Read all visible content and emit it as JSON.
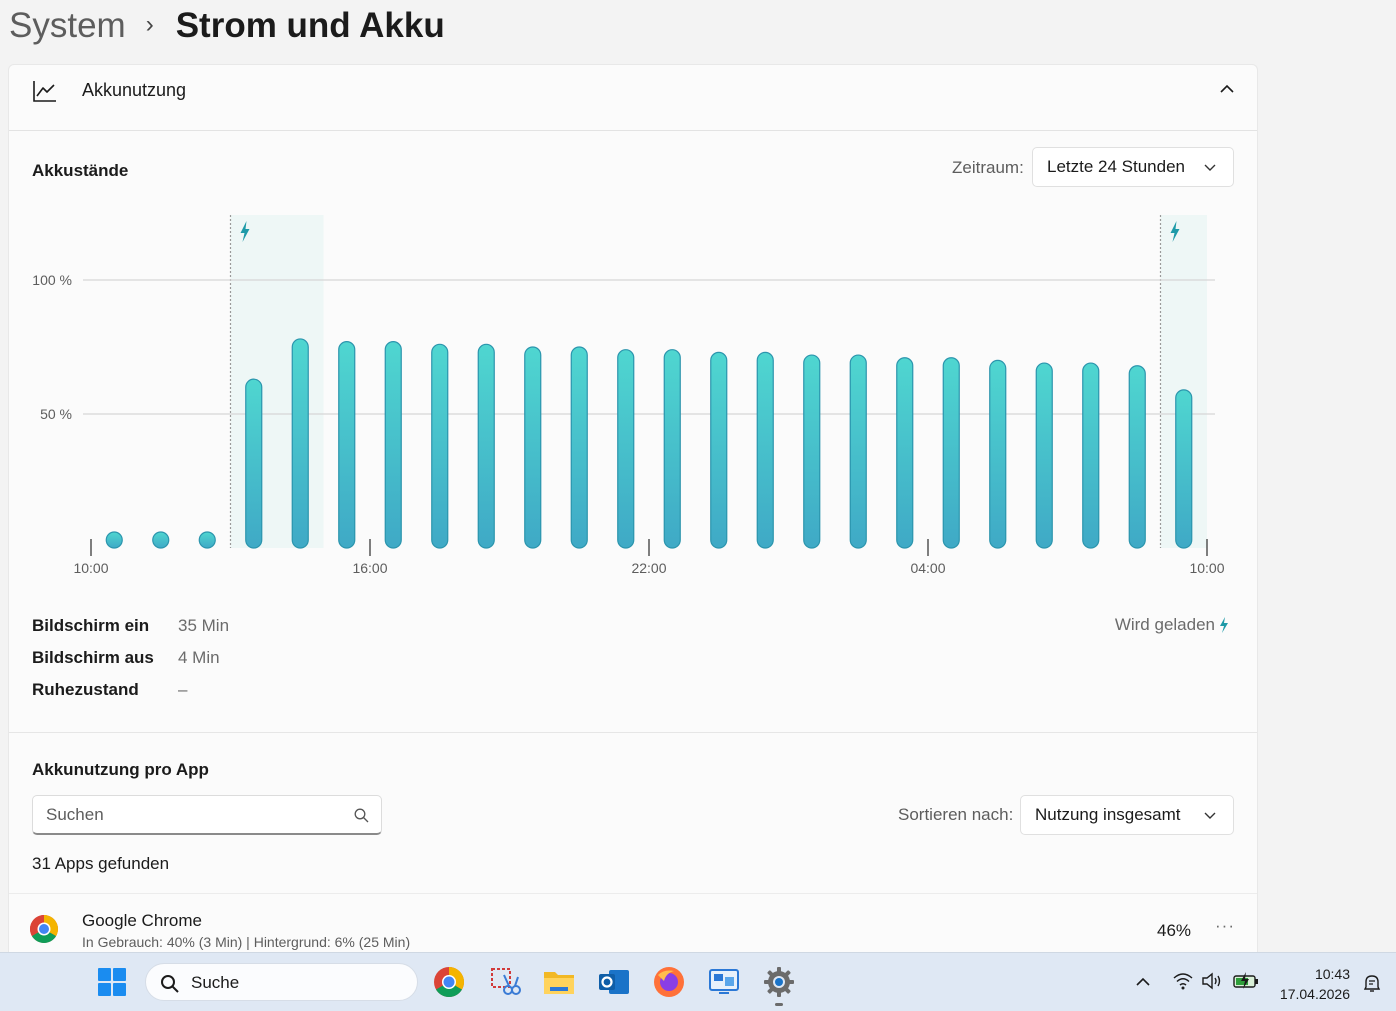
{
  "breadcrumb": {
    "parent": "System",
    "separator": "›",
    "current": "Strom und Akku"
  },
  "panel": {
    "title": "Akkunutzung"
  },
  "battery_levels": {
    "title": "Akkustände",
    "period_label": "Zeitraum:",
    "period_value": "Letzte 24 Stunden"
  },
  "chart_data": {
    "type": "bar",
    "y_ticks": [
      "100 %",
      "50 %"
    ],
    "ylim": [
      0,
      100
    ],
    "x_tick_labels": [
      "10:00",
      "16:00",
      "22:00",
      "04:00",
      "10:00"
    ],
    "x_tick_hours": [
      0,
      6,
      12,
      18,
      24
    ],
    "bar_hours": [
      0.5,
      1.5,
      2.5,
      3.5,
      4.5,
      5.5,
      6.5,
      7.5,
      8.5,
      9.5,
      10.5,
      11.5,
      12.5,
      13.5,
      14.5,
      15.5,
      16.5,
      17.5,
      18.5,
      19.5,
      20.5,
      21.5,
      22.5,
      23.5
    ],
    "values": [
      0,
      0,
      0,
      63,
      78,
      77,
      77,
      76,
      76,
      75,
      75,
      74,
      74,
      73,
      73,
      72,
      72,
      71,
      71,
      70,
      69,
      69,
      68,
      59
    ],
    "no_data_markers": [
      0,
      1,
      2
    ],
    "charging_periods": [
      [
        3,
        5
      ],
      [
        23,
        24
      ]
    ],
    "grid": true,
    "colors": {
      "bar_top": "#4fd6d0",
      "bar_bottom": "#3fa9c6",
      "bar_stroke": "#2b95ad",
      "charging_band": "#eef7f6",
      "bolt": "#1e9aa8",
      "grid": "#d6d6d6"
    }
  },
  "stats": [
    {
      "label": "Bildschirm ein",
      "value": "35 Min"
    },
    {
      "label": "Bildschirm aus",
      "value": "4 Min"
    },
    {
      "label": "Ruhezustand",
      "value": "–"
    }
  ],
  "charging_note": "Wird geladen",
  "per_app": {
    "title": "Akkunutzung pro App",
    "search_placeholder": "Suchen",
    "sort_label": "Sortieren nach:",
    "sort_value": "Nutzung insgesamt",
    "apps_found": "31 Apps gefunden",
    "apps": [
      {
        "name": "Google Chrome",
        "detail": "In Gebrauch: 40% (3 Min) | Hintergrund: 6% (25 Min)",
        "percent": "46%",
        "more": "···"
      }
    ]
  },
  "taskbar": {
    "search_label": "Suche",
    "apps": [
      "chrome-icon",
      "snipping-tool-icon",
      "file-explorer-icon",
      "outlook-icon",
      "firefox-icon",
      "remote-desktop-icon",
      "settings-icon"
    ],
    "time": "10:43",
    "date": "17.04.2026"
  }
}
